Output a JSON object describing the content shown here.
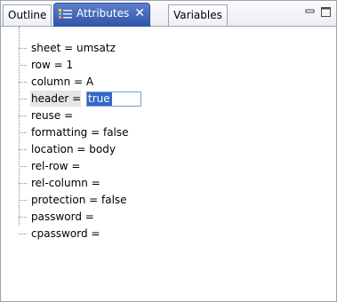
{
  "tabs": [
    {
      "label": "Outline",
      "active": false
    },
    {
      "label": "Attributes",
      "active": true,
      "icon": "attributes-icon",
      "close": "✕"
    },
    {
      "label": "Variables",
      "active": false
    }
  ],
  "window_controls": [
    "minimize-icon",
    "maximize-icon"
  ],
  "tree": {
    "items": [
      {
        "label": "sheet = umsatz"
      },
      {
        "label": "row = 1"
      },
      {
        "label": "column = A"
      },
      {
        "label": "header = ",
        "editing": true,
        "edit_value": "true"
      },
      {
        "label": "reuse ="
      },
      {
        "label": "formatting = false"
      },
      {
        "label": "location = body"
      },
      {
        "label": "rel-row ="
      },
      {
        "label": "rel-column ="
      },
      {
        "label": "protection = false"
      },
      {
        "label": "password ="
      },
      {
        "label": "cpassword ="
      }
    ]
  },
  "colors": {
    "active_tab": "#2f54a8",
    "selection": "#316ac5",
    "tree_line": "#8a8a8a"
  }
}
